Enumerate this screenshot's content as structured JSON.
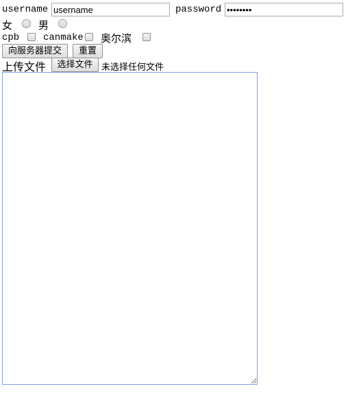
{
  "form": {
    "username_label": "username",
    "username_value": "username",
    "password_label": "password",
    "password_value": "12345678",
    "gender_female": "女",
    "gender_male": "男",
    "hobby_1": "cpb",
    "hobby_2": "canmake",
    "hobby_3": "奥尔滨",
    "submit_label": "向服务器提交",
    "reset_label": "重置",
    "upload_label": "上传文件",
    "choose_file_label": "选择文件",
    "no_file_text": "未选择任何文件",
    "textarea_value": ""
  }
}
